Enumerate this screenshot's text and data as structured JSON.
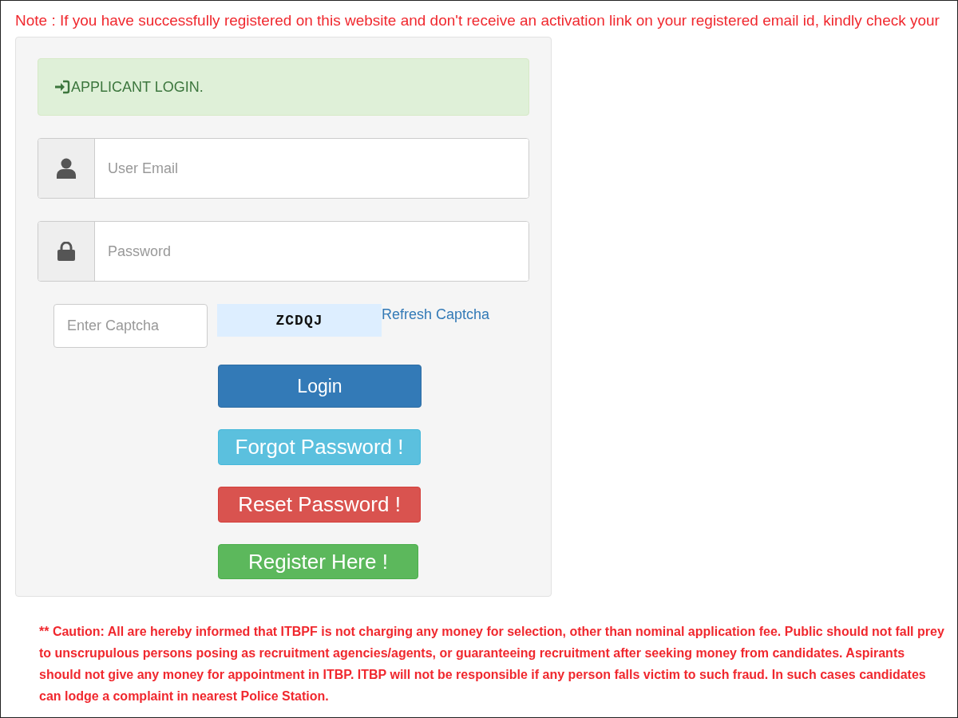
{
  "note": "Note : If you have successfully registered on this website and don't receive an activation link on your registered email id, kindly check your",
  "login": {
    "title": "APPLICANT LOGIN.",
    "fields": [
      {
        "kind": "text",
        "placeholder": "User Email"
      },
      {
        "kind": "password",
        "placeholder": "Password"
      }
    ],
    "captcha": {
      "placeholder": "Enter Captcha",
      "code": "ZCDQJ",
      "refresh": "Refresh Captcha"
    },
    "buttons": [
      {
        "kind": "primary",
        "label": "Login"
      },
      {
        "kind": "info",
        "label": "Forgot Password !"
      },
      {
        "kind": "danger",
        "label": "Reset Password !"
      },
      {
        "kind": "success",
        "label": "Register Here !"
      }
    ]
  },
  "caution": "** Caution: All are hereby informed that ITBPF is not charging any money for selection, other than nominal application fee. Public should not fall prey to unscrupulous persons posing as recruitment agencies/agents, or guaranteeing recruitment after seeking money from candidates. Aspirants should not give any money for appointment in ITBP. ITBP will not be responsible if any person falls victim to such fraud. In such cases candidates can lodge a complaint in nearest Police Station."
}
